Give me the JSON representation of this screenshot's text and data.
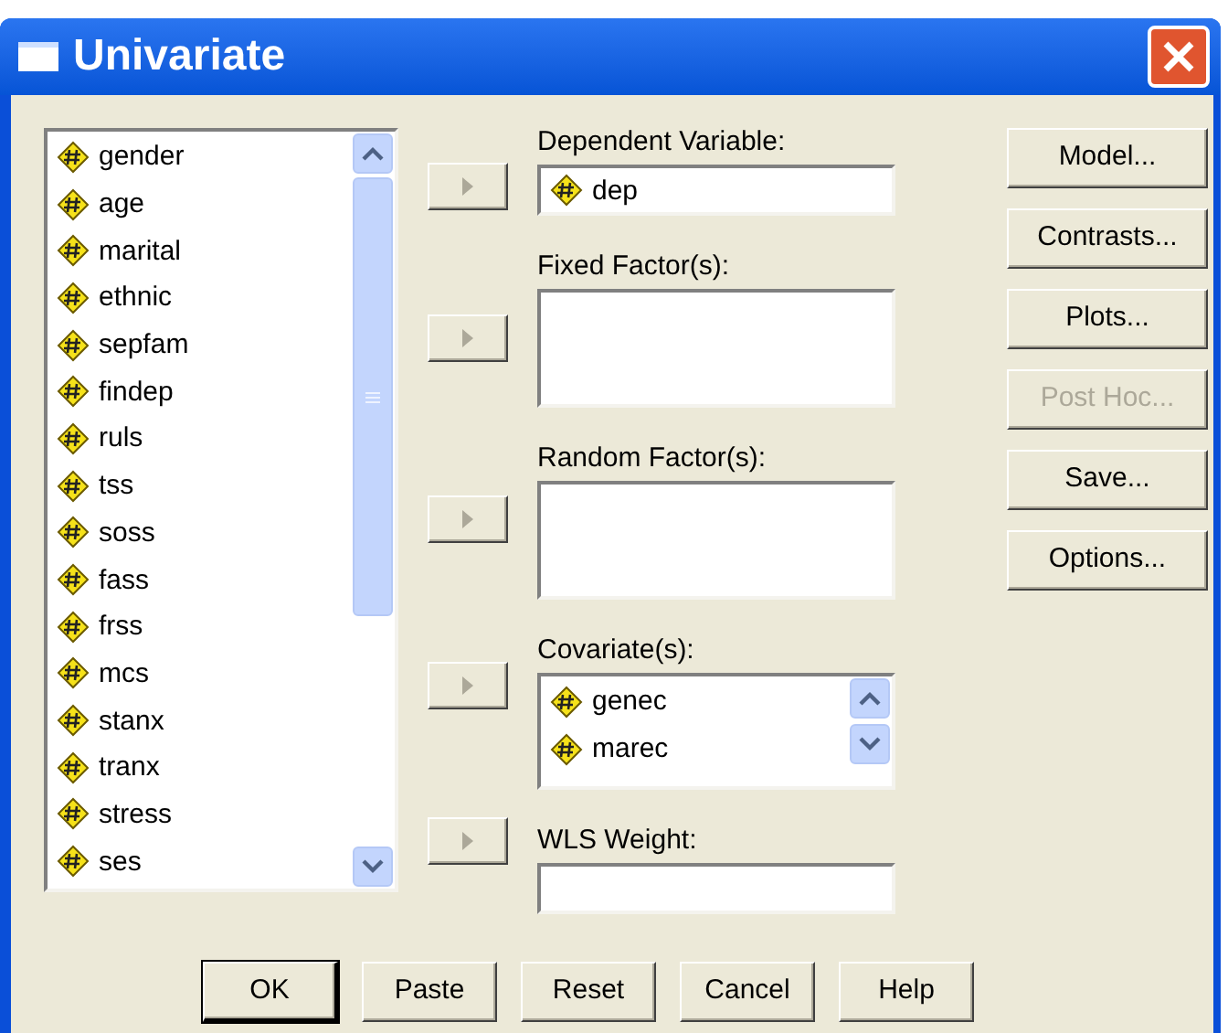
{
  "window": {
    "title": "Univariate"
  },
  "variables": [
    "gender",
    "age",
    "marital",
    "ethnic",
    "sepfam",
    "findep",
    "ruls",
    "tss",
    "soss",
    "fass",
    "frss",
    "mcs",
    "stanx",
    "tranx",
    "stress",
    "ses"
  ],
  "targets": [
    {
      "kind": "single",
      "label": "Dependent Variable:",
      "items": [
        "dep"
      ]
    },
    {
      "kind": "box",
      "label": "Fixed Factor(s):"
    },
    {
      "kind": "box",
      "label": "Random Factor(s):"
    },
    {
      "kind": "scrolllist",
      "label": "Covariate(s):",
      "items": [
        "genec",
        "marec"
      ]
    },
    {
      "kind": "single",
      "label": "WLS Weight:"
    }
  ],
  "side_buttons": [
    {
      "label": "Model...",
      "disabled": false
    },
    {
      "label": "Contrasts...",
      "disabled": false
    },
    {
      "label": "Plots...",
      "disabled": false
    },
    {
      "label": "Post Hoc...",
      "disabled": true
    },
    {
      "label": "Save...",
      "disabled": false
    },
    {
      "label": "Options...",
      "disabled": false
    }
  ],
  "bottom_buttons": [
    {
      "label": "OK",
      "default": true
    },
    {
      "label": "Paste",
      "default": false
    },
    {
      "label": "Reset",
      "default": false
    },
    {
      "label": "Cancel",
      "default": false
    },
    {
      "label": "Help",
      "default": false
    }
  ]
}
